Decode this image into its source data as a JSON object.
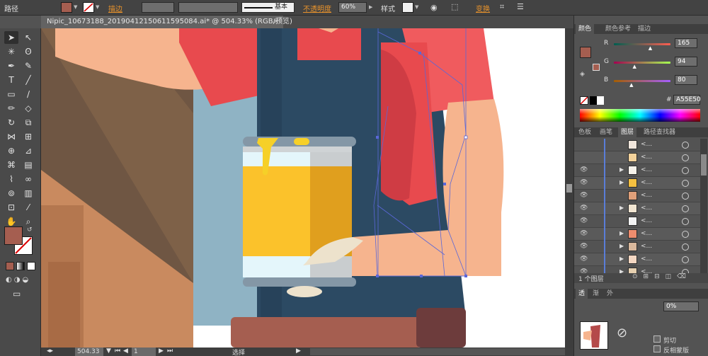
{
  "control_bar": {
    "object_type": "路径",
    "fill_color": "#A55E50",
    "stroke_label": "描边",
    "stroke_profile": "基本",
    "opacity_label": "不透明度",
    "opacity_value": "60%",
    "style_label": "样式",
    "transform_label": "变换"
  },
  "document": {
    "tab_title": "Nipic_10673188_20190412150611595084.ai* @ 504.33% (RGB/预览)",
    "close_glyph": "×",
    "zoom": "504.33",
    "artboard_number": "1",
    "status_tool": "选择"
  },
  "color_panel": {
    "tabs": [
      "颜色",
      "颜色参考",
      "描边"
    ],
    "r_label": "R",
    "g_label": "G",
    "b_label": "B",
    "r_value": "165",
    "g_value": "94",
    "b_value": "80",
    "hex_prefix": "#",
    "hex_value": "A55E50",
    "r_frac": 0.647,
    "g_frac": 0.369,
    "b_frac": 0.314
  },
  "layers_panel": {
    "tabs": [
      "色板",
      "画笔",
      "图层",
      "路径查找器"
    ],
    "row_dots": "<...",
    "footer_count": "1 个图层",
    "rows": [
      {
        "visible": false,
        "expand": false,
        "thumb": "#f0e6dc"
      },
      {
        "visible": false,
        "expand": false,
        "thumb": "#f3d29b"
      },
      {
        "visible": true,
        "expand": true,
        "thumb": "#f6f2ea"
      },
      {
        "visible": true,
        "expand": true,
        "thumb": "#f5c040"
      },
      {
        "visible": true,
        "expand": false,
        "thumb": "#e0a07a"
      },
      {
        "visible": true,
        "expand": true,
        "thumb": "#f2e6d2"
      },
      {
        "visible": true,
        "expand": false,
        "thumb": "#f3f3f3"
      },
      {
        "visible": true,
        "expand": true,
        "thumb": "#ef8d6e"
      },
      {
        "visible": true,
        "expand": true,
        "thumb": "#d9b89c"
      },
      {
        "visible": true,
        "expand": true,
        "thumb": "#f4d7c2"
      },
      {
        "visible": true,
        "expand": true,
        "thumb": "#e6d0b0"
      },
      {
        "visible": true,
        "expand": false,
        "thumb": "#b44a4a"
      }
    ]
  },
  "bottom_panel": {
    "tabs": [
      "透",
      "渐",
      "外"
    ],
    "opacity_value": "0%",
    "clip_label": "剪切",
    "invert_label": "反相蒙版"
  },
  "colors": {
    "skin": "#f6b48e",
    "apron": "#2c4a63",
    "shirt": "#e84a4e",
    "canvas_bg": "#ffffff",
    "selection": "#5a67d8"
  }
}
